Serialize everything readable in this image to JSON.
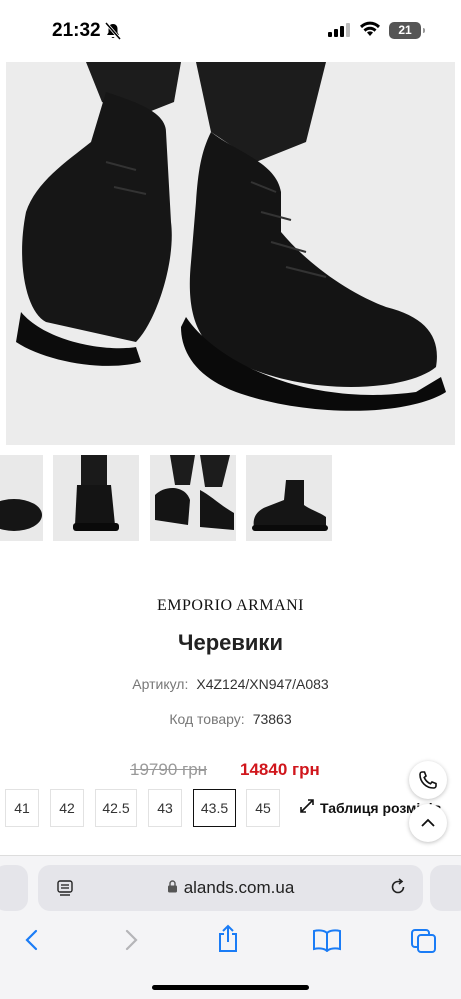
{
  "status_bar": {
    "time": "21:32",
    "battery": "21",
    "icons": [
      "bell-off-icon",
      "signal-icon",
      "wifi-icon",
      "battery-icon"
    ]
  },
  "product": {
    "brand": "EMPORIO ARMANI",
    "title": "Черевики",
    "article_label": "Артикул:",
    "article_value": "X4Z124/XN947/A083",
    "code_label": "Код товару:",
    "code_value": "73863",
    "old_price": "19790 грн",
    "new_price": "14840 грн",
    "sizes": [
      "41",
      "42",
      "42.5",
      "43",
      "43.5",
      "45"
    ],
    "selected_size": "43.5",
    "size_table_label": "Таблиця розмірів"
  },
  "thumbnails": [
    "sole-view",
    "back-view",
    "worn-view",
    "side-view"
  ],
  "browser": {
    "url": "alands.com.ua",
    "toolbar_icons": [
      "back-icon",
      "forward-icon",
      "share-icon",
      "bookmarks-icon",
      "tabs-icon"
    ]
  },
  "colors": {
    "accent": "#d0161c",
    "ios_blue": "#1a7cf6"
  }
}
